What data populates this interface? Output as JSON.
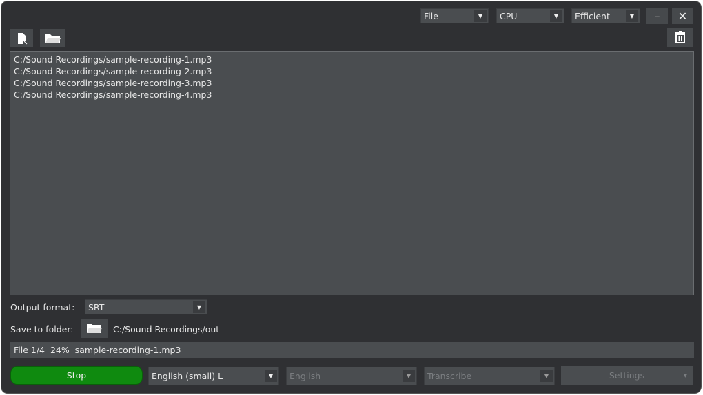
{
  "toolbar": {
    "source": "File",
    "device": "CPU",
    "mode": "Efficient",
    "minimize_icon": "minimize-icon",
    "close_icon": "close-icon"
  },
  "files": [
    "C:/Sound Recordings/sample-recording-1.mp3",
    "C:/Sound Recordings/sample-recording-2.mp3",
    "C:/Sound Recordings/sample-recording-3.mp3",
    "C:/Sound Recordings/sample-recording-4.mp3"
  ],
  "output": {
    "format_label": "Output format:",
    "format_value": "SRT",
    "folder_label": "Save to folder:",
    "folder_path": "C:/Sound Recordings/out"
  },
  "status": {
    "text": "File 1/4  24%  sample-recording-1.mp3",
    "progress_percent": 24
  },
  "bottom": {
    "stop": "Stop",
    "model": "English (small) L",
    "language": "English",
    "task": "Transcribe",
    "settings": "Settings"
  },
  "colors": {
    "stop": "#0f8a0f",
    "bg": "#2f3033",
    "panel": "#4a4d50"
  }
}
